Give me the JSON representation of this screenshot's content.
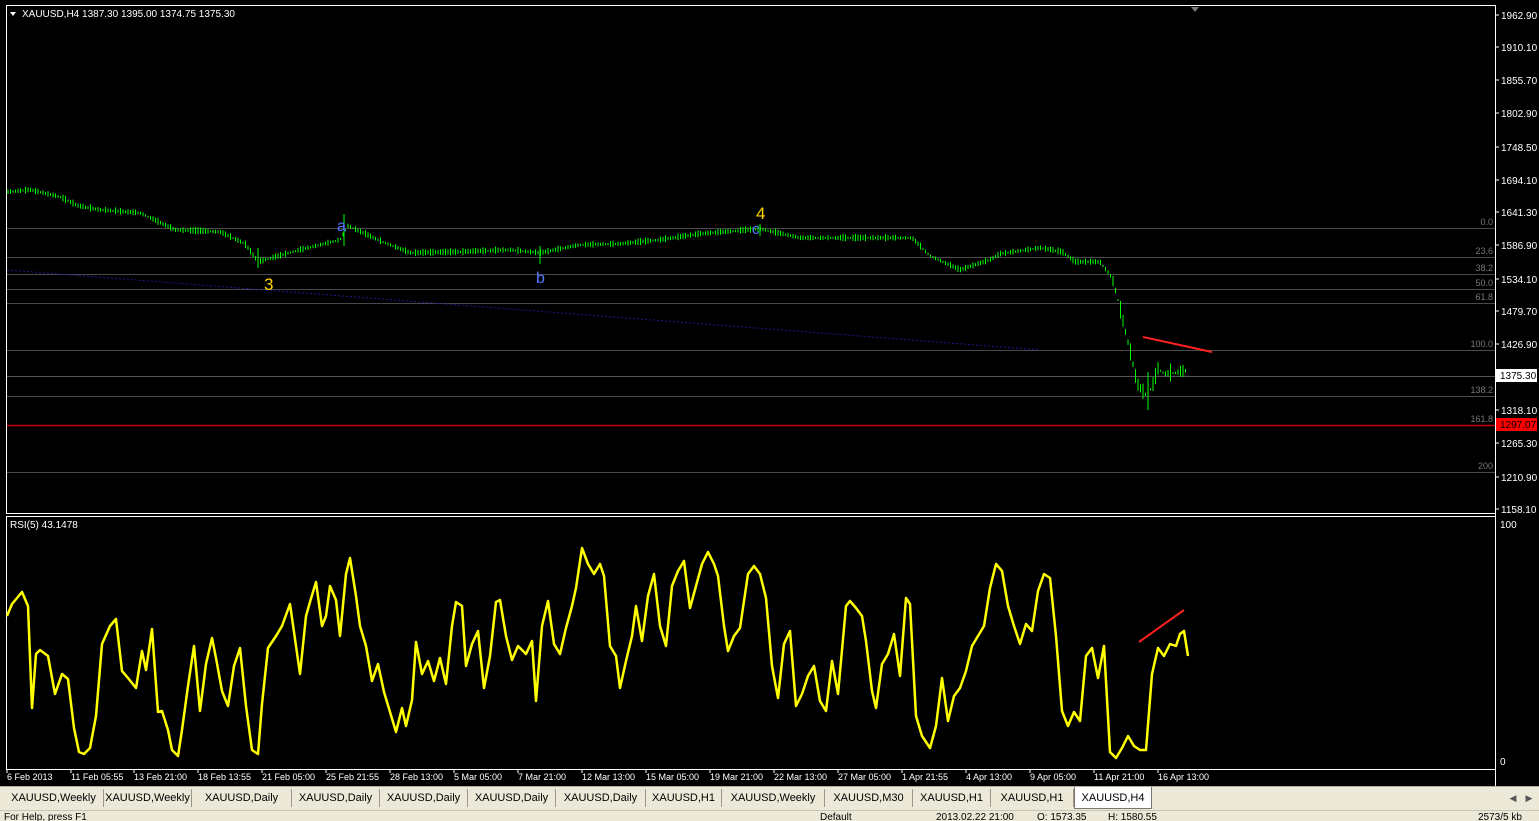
{
  "main": {
    "header": "XAUUSD,H4  1387.30 1395.00 1374.75 1375.30",
    "price_labels": [
      "1962.90",
      "1910.10",
      "1855.70",
      "1802.90",
      "1748.50",
      "1694.10",
      "1641.30",
      "1586.90",
      "1534.10",
      "1479.70",
      "1426.90",
      "1375.30",
      "1318.10",
      "1265.30",
      "1210.90",
      "1158.10"
    ],
    "current_price": "1375.30",
    "red_line_price": "1297.07",
    "fib_labels": [
      "0.0",
      "23.6",
      "38.2",
      "50.0",
      "61.8",
      "100.0",
      "138.2",
      "161.8",
      "200"
    ],
    "wave_labels": [
      {
        "text": "a",
        "color": "#5577ff"
      },
      {
        "text": "b",
        "color": "#5577ff"
      },
      {
        "text": "c",
        "color": "#5577ff"
      },
      {
        "text": "3",
        "color": "#ffd700"
      },
      {
        "text": "4",
        "color": "#ffd700"
      }
    ],
    "colors": {
      "price": "#00ff00",
      "rsi": "#ffff00",
      "trend": "#ff0000",
      "fib": "#666666"
    }
  },
  "rsi": {
    "header": "RSI(5) 43.1478",
    "level_100": "100",
    "level_0": "0"
  },
  "time_labels": [
    "6 Feb 2013",
    "11 Feb 05:55",
    "13 Feb 21:00",
    "18 Feb 13:55",
    "21 Feb 05:00",
    "25 Feb 21:55",
    "28 Feb 13:00",
    "5 Mar 05:00",
    "7 Mar 21:00",
    "12 Mar 13:00",
    "15 Mar 05:00",
    "19 Mar 21:00",
    "22 Mar 13:00",
    "27 Mar 05:00",
    "1 Apr 21:55",
    "4 Apr 13:00",
    "9 Apr 05:00",
    "11 Apr 21:00",
    "16 Apr 13:00"
  ],
  "tabs": [
    "XAUUSD,Weekly",
    "XAUUSD,Weekly",
    "XAUUSD,Daily",
    "XAUUSD,Daily",
    "XAUUSD,Daily",
    "XAUUSD,Daily",
    "XAUUSD,Daily",
    "XAUUSD,H1",
    "XAUUSD,Weekly",
    "XAUUSD,M30",
    "XAUUSD,H1",
    "XAUUSD,H1",
    "XAUUSD,H4"
  ],
  "status": {
    "help": "For Help, press F1",
    "profile": "Default",
    "datetime": "2013.02.22 21:00",
    "open": "O: 1573.35",
    "high": "H: 1580.55",
    "traffic": "2573/5 kb"
  }
}
